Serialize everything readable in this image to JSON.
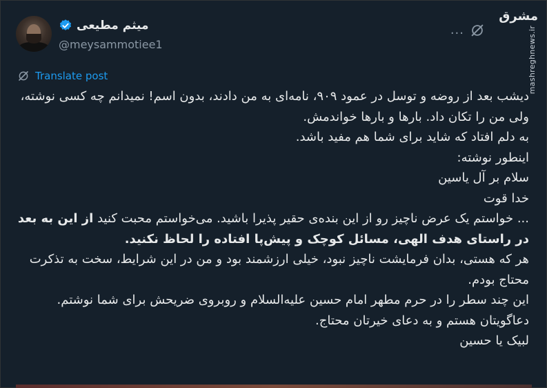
{
  "author": {
    "name": "میثم مطیعی",
    "handle": "@meysammotiee1"
  },
  "header": {
    "more_label": "..."
  },
  "watermark": {
    "logo": "مشرق",
    "url": "mashreghnews.ir"
  },
  "translate": {
    "label": "Translate post"
  },
  "post": {
    "lines": [
      "دیشب بعد از روضه و توسل در عمود ۹۰۹، نامه‌ای به من دادند، بدون اسم! نمیدانم چه کسی نوشته، ولی من را تکان داد. بارها و بارها خواندمش.",
      "به دلم افتاد که شاید برای شما هم مفید باشد.",
      "اینطور نوشته:",
      "سلام بر آل یاسین",
      "خدا قوت",
      "... خواستم یک عرض ناچیز رو از این بنده‌ی حقیر پذیرا باشید. می‌خواستم محبت کنید",
      "از این به بعد در راستای هدف الهی، مسائل کوچک و پیش‌پا افتاده را لحاظ نکنید.",
      "هر که هستی، بدان فرمایشت ناچیز نبود، خیلی ارزشمند بود و من در این شرایط، سخت به تذکرت محتاج بودم.",
      "این چند سطر را در حرم مطهر امام حسین علیه‌السلام و روبروی ضریحش برای شما نوشتم.",
      "دعاگویتان هستم و به دعای خیرتان محتاج.",
      "لبیک یا حسین"
    ]
  },
  "colors": {
    "background": "#15202b",
    "text": "#e7e9ea",
    "muted": "#8b98a5",
    "accent": "#1d9bf0"
  },
  "icons": {
    "verified": "verified-badge-icon",
    "grok": "grok-icon",
    "translate": "translate-icon"
  }
}
